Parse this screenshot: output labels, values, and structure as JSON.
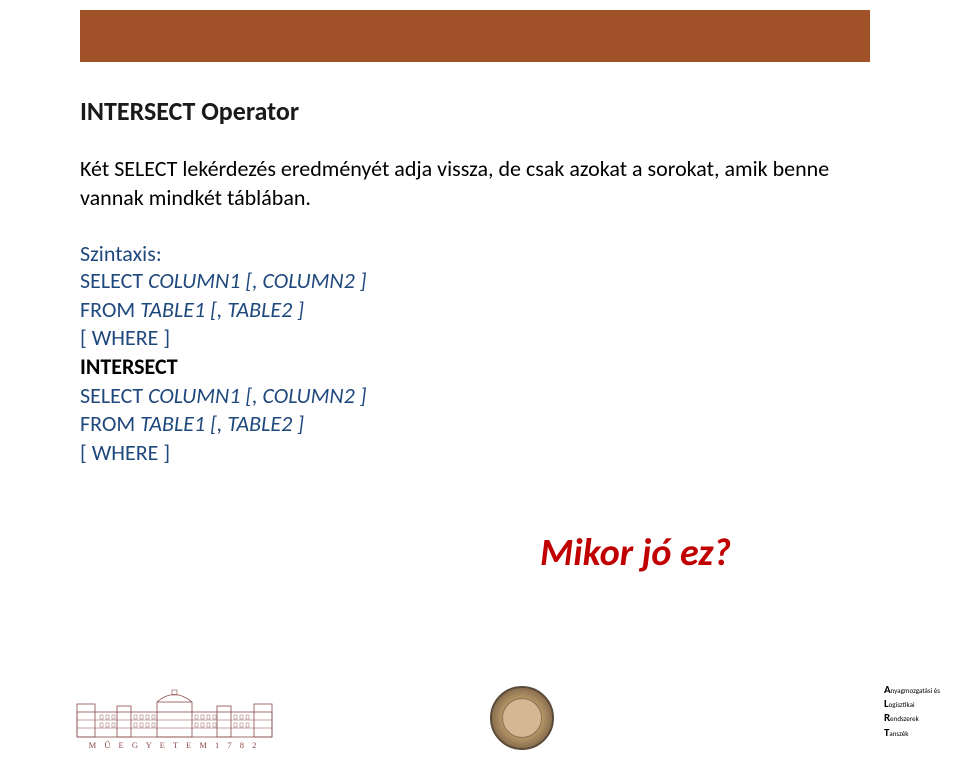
{
  "slide": {
    "title": "INTERSECT Operator",
    "description": "Két SELECT lekérdezés eredményét adja vissza, de csak azokat a sorokat, amik benne vannak mindkét táblában.",
    "syntax_label": "Szintaxis:",
    "syntax": {
      "line1_a": "SELECT ",
      "line1_b": "COLUMN1 [, COLUMN2 ]",
      "line2_a": "FROM ",
      "line2_b": "TABLE1 [, TABLE2 ]",
      "line3": "[ WHERE ]",
      "line4": "INTERSECT",
      "line5_a": "SELECT ",
      "line5_b": "COLUMN1 [, COLUMN2 ]",
      "line6_a": "FROM ",
      "line6_b": "TABLE1 [, TABLE2 ]",
      "line7": "[ WHERE ]"
    },
    "callout": "Mikor jó ez?"
  },
  "footer": {
    "logo_left_text": "M Ű E G Y E T E M   1 7 8 2",
    "logo_right": {
      "line1_big": "A",
      "line1_rest": "nyagmozgatási és",
      "line2_big": "L",
      "line2_rest": "ogisztikai",
      "line3_big": "R",
      "line3_rest": "endszerek",
      "line4_big": "T",
      "line4_rest": "anszék"
    }
  }
}
